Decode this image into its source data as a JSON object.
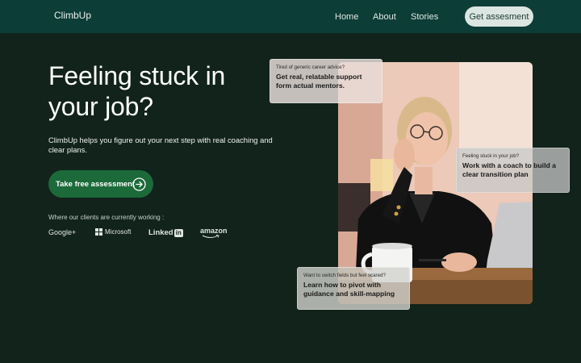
{
  "nav": {
    "logo": "ClimbUp",
    "links": [
      "Home",
      "About",
      "Stories"
    ],
    "cta": "Get assesment"
  },
  "hero": {
    "headline": "Feeling stuck in your job?",
    "subtext": "ClimbUp helps you figure out your next step with real coaching and clear plans.",
    "cta": "Take free assessment",
    "clients_label": "Where our clients are currently working :",
    "brands": [
      "Google+",
      "Microsoft",
      "Linked",
      "in",
      "amazon"
    ]
  },
  "cards": [
    {
      "small": "Tired of generic career advice?",
      "big": "Get real, relatable support form actual mentors."
    },
    {
      "small": "Feeling stuck in your job?",
      "big": "Work with a coach to build a clear transition plan"
    },
    {
      "small": "Want to switch fields but feel scared?",
      "big": "Learn how to pivot with guidance and skill-mapping"
    }
  ],
  "icons": {
    "cta_arrow": "arrow-right-circle-icon"
  },
  "colors": {
    "nav_bg": "#0d3d37",
    "page_bg": "#12231b",
    "cta_green": "#1c6a3a",
    "nav_button_bg": "#dbe5e2"
  }
}
